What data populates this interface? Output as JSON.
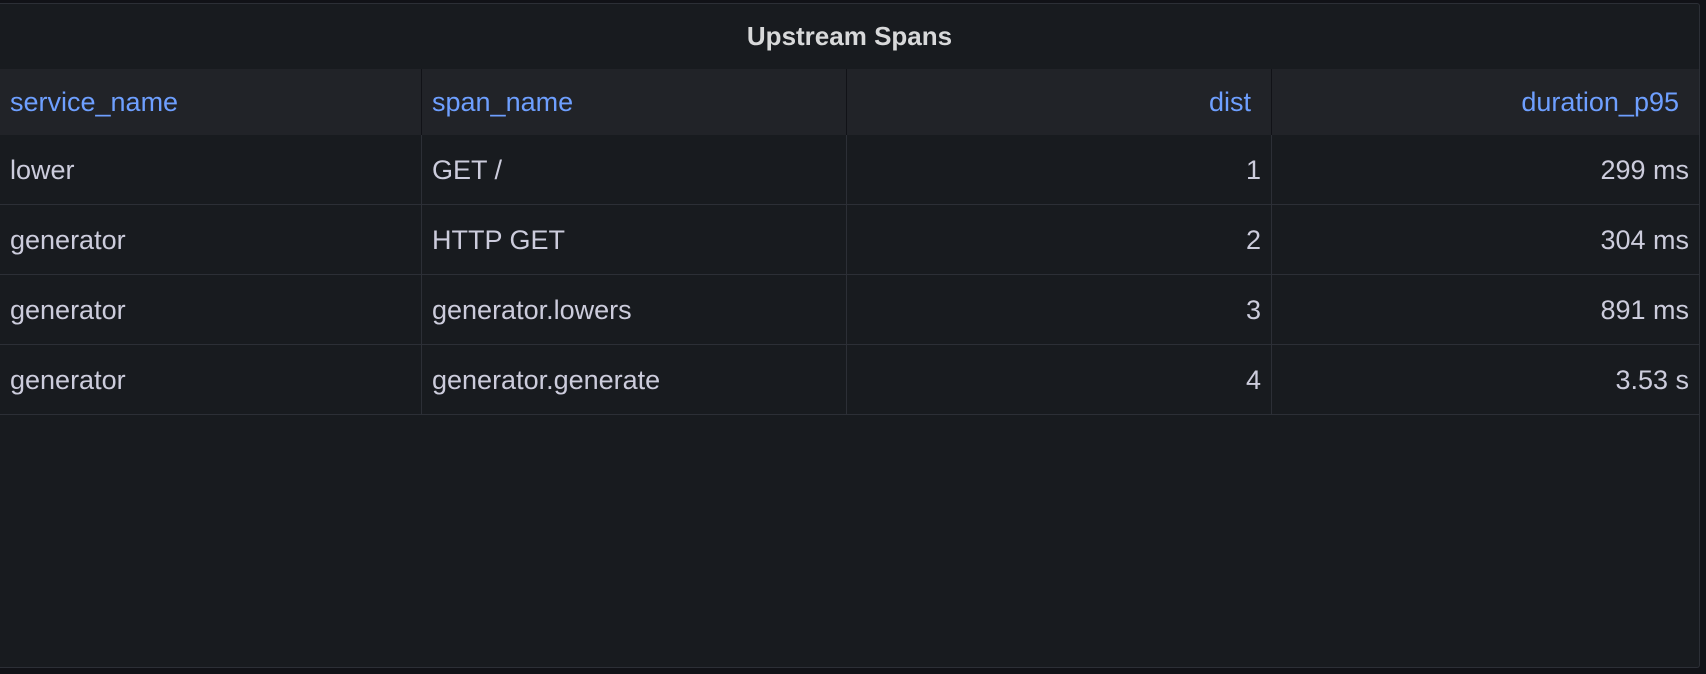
{
  "panel": {
    "title": "Upstream Spans"
  },
  "table": {
    "columns": [
      "service_name",
      "span_name",
      "dist",
      "duration_p95"
    ],
    "rows": [
      [
        "lower",
        "GET /",
        "1",
        "299 ms"
      ],
      [
        "generator",
        "HTTP GET",
        "2",
        "304 ms"
      ],
      [
        "generator",
        "generator.lowers",
        "3",
        "891 ms"
      ],
      [
        "generator",
        "generator.generate",
        "4",
        "3.53 s"
      ]
    ]
  },
  "colors": {
    "header_text": "#6e9fff",
    "panel_bg": "#181b1f",
    "header_bg": "#212328",
    "cell_text": "#ccccdc"
  }
}
